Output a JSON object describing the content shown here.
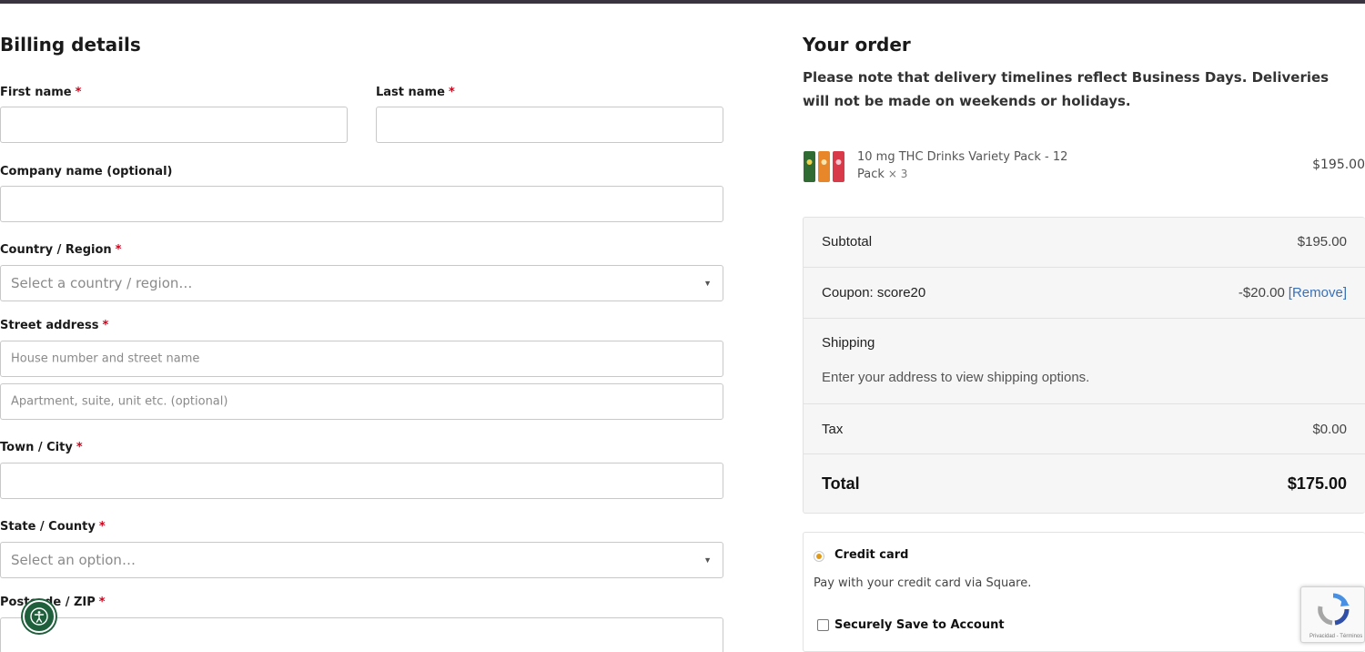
{
  "billing": {
    "title": "Billing details",
    "required_mark": "*",
    "first_name": {
      "label": "First name",
      "value": ""
    },
    "last_name": {
      "label": "Last name",
      "value": ""
    },
    "company": {
      "label": "Company name (optional)",
      "value": ""
    },
    "country": {
      "label": "Country / Region",
      "placeholder": "Select a country / region…"
    },
    "street": {
      "label": "Street address",
      "placeholder1": "House number and street name",
      "placeholder2": "Apartment, suite, unit etc. (optional)"
    },
    "city": {
      "label": "Town / City",
      "value": ""
    },
    "state": {
      "label": "State / County",
      "placeholder": "Select an option…"
    },
    "postcode": {
      "label": "Postcode / ZIP",
      "value": ""
    }
  },
  "order": {
    "title": "Your order",
    "note": "Please note that delivery timelines reflect Business Days. Deliveries will not be made on weekends or holidays.",
    "item": {
      "name": "10 mg THC Drinks Variety Pack - 12 Pack",
      "qty": "× 3",
      "price": "$195.00"
    },
    "subtotal": {
      "label": "Subtotal",
      "value": "$195.00"
    },
    "coupon": {
      "label": "Coupon: score20",
      "value": "-$20.00",
      "remove": "[Remove]"
    },
    "shipping": {
      "label": "Shipping",
      "note": "Enter your address to view shipping options."
    },
    "tax": {
      "label": "Tax",
      "value": "$0.00"
    },
    "total": {
      "label": "Total",
      "value": "$175.00"
    }
  },
  "payment": {
    "method": "Credit card",
    "description": "Pay with your credit card via Square.",
    "save_label": "Securely Save to Account",
    "accent_color": "#e09a1a"
  },
  "recaptcha": {
    "text": "Privacidad - Términos"
  },
  "colors": {
    "accessibility_button": "#1f5f3c",
    "required": "#d0021b",
    "link": "#3b6fb6"
  }
}
